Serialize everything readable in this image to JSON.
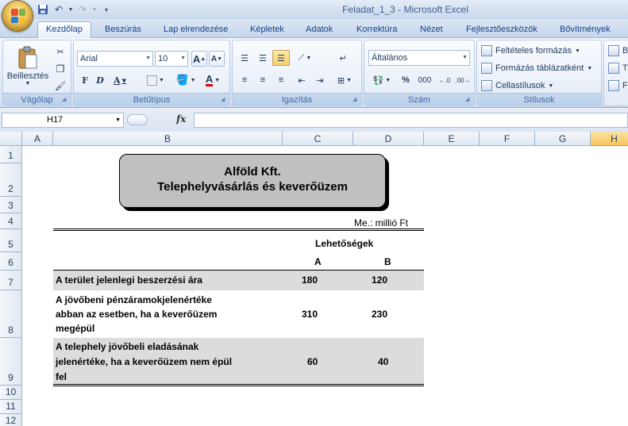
{
  "window": {
    "title": "Feladat_1_3 - Microsoft Excel"
  },
  "tabs": [
    "Kezdőlap",
    "Beszúrás",
    "Lap elrendezése",
    "Képletek",
    "Adatok",
    "Korrektúra",
    "Nézet",
    "Fejlesztőeszközök",
    "Bővítmények"
  ],
  "ribbon": {
    "clipboard": {
      "paste_label": "Beillesztés",
      "group_label": "Vágólap"
    },
    "font": {
      "font_name": "Arial",
      "font_size": "10",
      "bold": "F",
      "italic": "D",
      "underline": "A",
      "font_color_letter": "A",
      "grow": "A",
      "shrink": "A",
      "group_label": "Betűtípus"
    },
    "alignment": {
      "group_label": "Igazítás"
    },
    "number": {
      "format": "Általános",
      "percent": "%",
      "thousands": "000",
      "group_label": "Szám"
    },
    "styles": {
      "conditional": "Feltételes formázás",
      "format_table": "Formázás táblázatként",
      "cell_styles": "Cellastílusok",
      "group_label": "Stílusok"
    },
    "cells": {
      "insert_initial": "B",
      "delete_initial": "T",
      "format_initial": "F"
    }
  },
  "formula_bar": {
    "name_box": "H17",
    "fx": "fx",
    "content": ""
  },
  "columns": [
    "A",
    "B",
    "C",
    "D",
    "E",
    "F",
    "G",
    "H"
  ],
  "active_column": "H",
  "rows": [
    "1",
    "2",
    "3",
    "4",
    "5",
    "6",
    "7",
    "8",
    "9",
    "10",
    "11",
    "12"
  ],
  "sheet": {
    "title_line1": "Alföld Kft.",
    "title_line2": "Telephelyvásárlás és keverőüzem",
    "unit": "Me.: millió Ft",
    "header_group": "Lehetőségek",
    "header_a": "A",
    "header_b": "B",
    "rows": [
      {
        "label_lines": [
          "A terület jelenlegi beszerzési ára"
        ],
        "a": "180",
        "b": "120"
      },
      {
        "label_lines": [
          "A jövőbeni pénzáramokjelenértéke",
          "abban az esetben, ha a keverőüzem",
          "megépül"
        ],
        "a": "310",
        "b": "230"
      },
      {
        "label_lines": [
          "A telephely jövőbeli eladásának",
          "jelenértéke, ha a keverőüzem nem épül",
          "fel"
        ],
        "a": "60",
        "b": "40"
      }
    ]
  }
}
